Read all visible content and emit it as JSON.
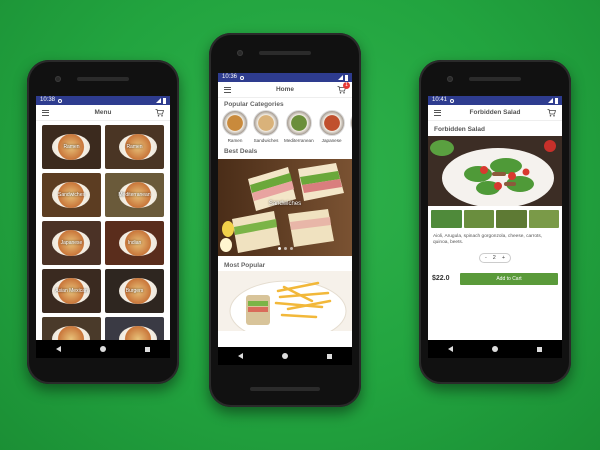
{
  "left_phone": {
    "status_time": "10:38",
    "title": "Menu",
    "tiles": [
      {
        "label": "Ramen",
        "bg": "#3b2a1e"
      },
      {
        "label": "Ramen",
        "bg": "#4a3524"
      },
      {
        "label": "Sandwiches",
        "bg": "#5c3d22"
      },
      {
        "label": "Mediterranean",
        "bg": "#6a5a3a"
      },
      {
        "label": "Japanese",
        "bg": "#4b3226"
      },
      {
        "label": "Indian",
        "bg": "#5a2d1c"
      },
      {
        "label": "Asian Mexican",
        "bg": "#3a2a20"
      },
      {
        "label": "Burgers",
        "bg": "#2e2620"
      },
      {
        "label": "",
        "bg": "#4a3a2a"
      },
      {
        "label": "",
        "bg": "#3a3a44"
      }
    ]
  },
  "center_phone": {
    "status_time": "10:36",
    "title": "Home",
    "cart_count": "1",
    "popular_categories_title": "Popular Categories",
    "categories": [
      {
        "label": "Ramen",
        "color": "#c98a3c"
      },
      {
        "label": "Sandwiches",
        "color": "#d9b27a"
      },
      {
        "label": "Mediterranean",
        "color": "#6b8f3a"
      },
      {
        "label": "Japanese",
        "color": "#c0502e"
      },
      {
        "label": "Su",
        "color": "#e07b3a"
      }
    ],
    "best_deals_title": "Best Deals",
    "best_deals_label": "Sandwiches",
    "most_popular_title": "Most Popular"
  },
  "right_phone": {
    "status_time": "10:41",
    "title": "Forbidden Salad",
    "dish_title": "Forbidden Salad",
    "description": "Aioli, Arugula, spinach gorgonzola, cheese, carrots, quinoa, beets.",
    "quantity": "2",
    "minus": "-",
    "plus": "+",
    "price": "$22.0",
    "add_to_cart": "Add to Cart"
  }
}
